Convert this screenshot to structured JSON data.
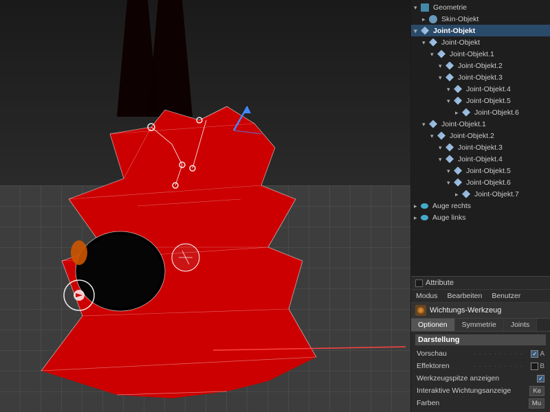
{
  "viewport": {
    "background_top": "#1a1a1a",
    "background_bottom": "#3d3d3d"
  },
  "scene_tree": {
    "items": [
      {
        "id": "geometrie",
        "label": "Geometrie",
        "indent": 0,
        "icon": "geo",
        "expanded": true
      },
      {
        "id": "skin-objekt",
        "label": "Skin-Objekt",
        "indent": 1,
        "icon": "skin",
        "expanded": false
      },
      {
        "id": "joint-objekt-root",
        "label": "Joint-Objekt",
        "indent": 0,
        "icon": "joint",
        "expanded": true,
        "active": true
      },
      {
        "id": "joint-objekt-1a",
        "label": "Joint-Objekt",
        "indent": 1,
        "icon": "joint",
        "expanded": true
      },
      {
        "id": "joint-objekt-1-1",
        "label": "Joint-Objekt.1",
        "indent": 2,
        "icon": "joint",
        "expanded": true
      },
      {
        "id": "joint-objekt-2-1",
        "label": "Joint-Objekt.2",
        "indent": 3,
        "icon": "joint",
        "expanded": true
      },
      {
        "id": "joint-objekt-3-1",
        "label": "Joint-Objekt.3",
        "indent": 3,
        "icon": "joint",
        "expanded": true
      },
      {
        "id": "joint-objekt-4-1",
        "label": "Joint-Objekt.4",
        "indent": 4,
        "icon": "joint",
        "expanded": true
      },
      {
        "id": "joint-objekt-5-1",
        "label": "Joint-Objekt.5",
        "indent": 4,
        "icon": "joint",
        "expanded": true
      },
      {
        "id": "joint-objekt-6-1",
        "label": "Joint-Objekt.6",
        "indent": 5,
        "icon": "joint",
        "expanded": false
      },
      {
        "id": "joint-objekt-1b",
        "label": "Joint-Objekt.1",
        "indent": 1,
        "icon": "joint",
        "expanded": true
      },
      {
        "id": "joint-objekt-2b",
        "label": "Joint-Objekt.2",
        "indent": 2,
        "icon": "joint",
        "expanded": true
      },
      {
        "id": "joint-objekt-3b",
        "label": "Joint-Objekt.3",
        "indent": 3,
        "icon": "joint",
        "expanded": true
      },
      {
        "id": "joint-objekt-4b",
        "label": "Joint-Objekt.4",
        "indent": 3,
        "icon": "joint",
        "expanded": true
      },
      {
        "id": "joint-objekt-5b",
        "label": "Joint-Objekt.5",
        "indent": 4,
        "icon": "joint",
        "expanded": true
      },
      {
        "id": "joint-objekt-6b",
        "label": "Joint-Objekt.6",
        "indent": 4,
        "icon": "joint",
        "expanded": true
      },
      {
        "id": "joint-objekt-7b",
        "label": "Joint-Objekt.7",
        "indent": 5,
        "icon": "joint",
        "expanded": false
      },
      {
        "id": "auge-rechts",
        "label": "Auge rechts",
        "indent": 0,
        "icon": "eye",
        "expanded": false
      },
      {
        "id": "auge-links",
        "label": "Auge links",
        "indent": 0,
        "icon": "eye",
        "expanded": false
      }
    ]
  },
  "attribute_panel": {
    "title": "Attribute",
    "menu_items": [
      "Modus",
      "Bearbeiten",
      "Benutzer"
    ],
    "tool_name": "Wichtungs-Werkzeug",
    "tabs": [
      "Optionen",
      "Symmetrie",
      "Joints"
    ],
    "section_darstellung": {
      "label": "Darstellung",
      "properties": [
        {
          "label": "Vorschau",
          "has_checkbox": true,
          "checked": true,
          "right_label": "A"
        },
        {
          "label": "Effektoren",
          "has_checkbox": true,
          "checked": false,
          "right_label": "B"
        },
        {
          "label": "Werkzeugspitze anzeigen",
          "has_checkbox": true,
          "checked": true,
          "right_label": ""
        }
      ],
      "interactive_label": "Interaktive Wichtungsanzeige",
      "interactive_value": "Ke",
      "farben_label": "Farben",
      "farben_value": "Mu"
    }
  }
}
